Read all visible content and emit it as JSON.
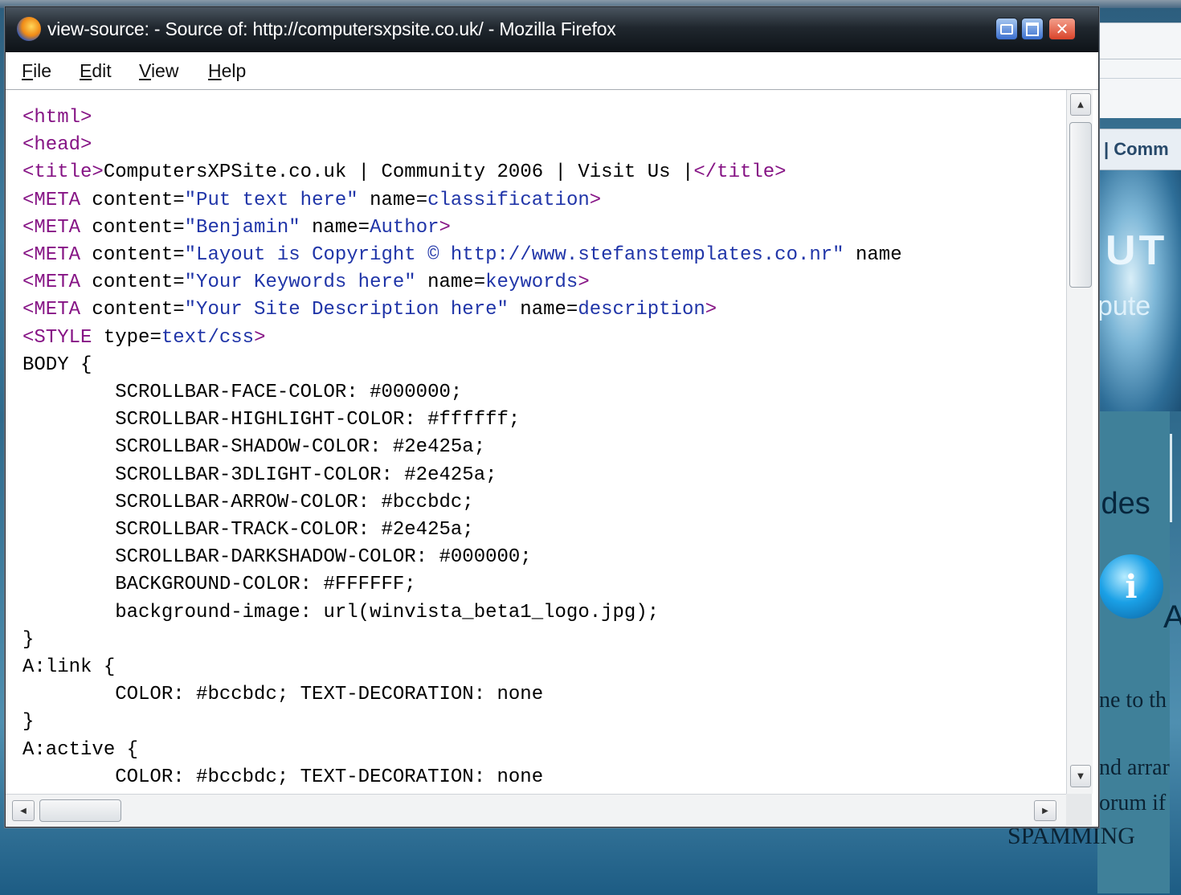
{
  "window": {
    "title": "view-source: - Source of: http://computersxpsite.co.uk/ - Mozilla Firefox",
    "app_icon": "firefox-icon",
    "controls": {
      "minimize": "minimize-icon",
      "maximize": "maximize-icon",
      "close": "close-icon",
      "close_glyph": "✕"
    }
  },
  "menu": [
    {
      "access_key": "F",
      "rest": "ile"
    },
    {
      "access_key": "E",
      "rest": "dit"
    },
    {
      "access_key": "V",
      "rest": "iew"
    },
    {
      "access_key": "H",
      "rest": "elp"
    }
  ],
  "source_lines": [
    [
      [
        "tag",
        "<html>"
      ]
    ],
    [
      [
        "tag",
        "<head>"
      ]
    ],
    [
      [
        "tag",
        "<title>"
      ],
      [
        "txt",
        "ComputersXPSite.co.uk | Community 2006 | Visit Us |"
      ],
      [
        "tag",
        "</title>"
      ]
    ],
    [
      [
        "tag",
        "<META "
      ],
      [
        "attr",
        "content="
      ],
      [
        "val",
        "\"Put text here\""
      ],
      [
        "attr",
        " name="
      ],
      [
        "val",
        "classification"
      ],
      [
        "tag",
        ">"
      ]
    ],
    [
      [
        "tag",
        "<META "
      ],
      [
        "attr",
        "content="
      ],
      [
        "val",
        "\"Benjamin\""
      ],
      [
        "attr",
        " name="
      ],
      [
        "val",
        "Author"
      ],
      [
        "tag",
        ">"
      ]
    ],
    [
      [
        "tag",
        "<META "
      ],
      [
        "attr",
        "content="
      ],
      [
        "val",
        "\"Layout is Copyright © http://www.stefanstemplates.co.nr\""
      ],
      [
        "attr",
        " name"
      ]
    ],
    [
      [
        "tag",
        "<META "
      ],
      [
        "attr",
        "content="
      ],
      [
        "val",
        "\"Your Keywords here\""
      ],
      [
        "attr",
        " name="
      ],
      [
        "val",
        "keywords"
      ],
      [
        "tag",
        ">"
      ]
    ],
    [
      [
        "tag",
        "<META "
      ],
      [
        "attr",
        "content="
      ],
      [
        "val",
        "\"Your Site Description here\""
      ],
      [
        "attr",
        " name="
      ],
      [
        "val",
        "description"
      ],
      [
        "tag",
        ">"
      ]
    ],
    [
      [
        "tag",
        "<STYLE "
      ],
      [
        "attr",
        "type="
      ],
      [
        "val",
        "text/css"
      ],
      [
        "tag",
        ">"
      ]
    ],
    [
      [
        "txt",
        "BODY {"
      ]
    ],
    [
      [
        "txt",
        "        SCROLLBAR-FACE-COLOR: #000000;"
      ]
    ],
    [
      [
        "txt",
        "        SCROLLBAR-HIGHLIGHT-COLOR: #ffffff;"
      ]
    ],
    [
      [
        "txt",
        "        SCROLLBAR-SHADOW-COLOR: #2e425a;"
      ]
    ],
    [
      [
        "txt",
        "        SCROLLBAR-3DLIGHT-COLOR: #2e425a;"
      ]
    ],
    [
      [
        "txt",
        "        SCROLLBAR-ARROW-COLOR: #bccbdc;"
      ]
    ],
    [
      [
        "txt",
        "        SCROLLBAR-TRACK-COLOR: #2e425a;"
      ]
    ],
    [
      [
        "txt",
        "        SCROLLBAR-DARKSHADOW-COLOR: #000000;"
      ]
    ],
    [
      [
        "txt",
        "        BACKGROUND-COLOR: #FFFFFF;"
      ]
    ],
    [
      [
        "txt",
        "        background-image: url(winvista_beta1_logo.jpg);"
      ]
    ],
    [
      [
        "txt",
        "}"
      ]
    ],
    [
      [
        "txt",
        "A:link {"
      ]
    ],
    [
      [
        "txt",
        "        COLOR: #bccbdc; TEXT-DECORATION: none"
      ]
    ],
    [
      [
        "txt",
        "}"
      ]
    ],
    [
      [
        "txt",
        "A:active {"
      ]
    ],
    [
      [
        "txt",
        "        COLOR: #bccbdc; TEXT-DECORATION: none"
      ]
    ]
  ],
  "background_page": {
    "nav_text": "| Comm",
    "banner_text_1": "UT",
    "banner_text_2": "pute",
    "heading_fragment": "ides",
    "info_icon": "info-icon",
    "info_icon_glyph": "i",
    "info_tail": "A",
    "text_1": "ne to th",
    "text_2": "nd arrar",
    "text_3": "orum if",
    "text_4": "SPAMMING"
  },
  "colors": {
    "tag": "#861485",
    "attribute_value": "#2035a8",
    "plain_text": "#000000"
  }
}
